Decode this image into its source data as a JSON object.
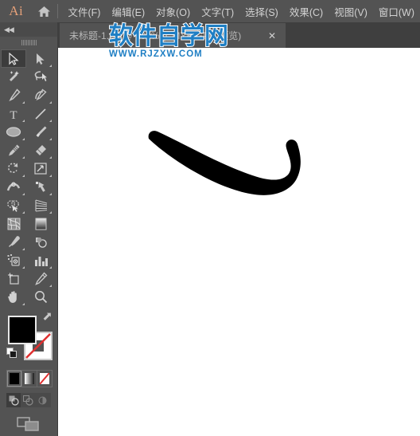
{
  "app": {
    "logo_text": "Ai",
    "home_icon": "home-icon"
  },
  "menubar": {
    "items": [
      {
        "label": "文件(F)",
        "name": "menu-file"
      },
      {
        "label": "编辑(E)",
        "name": "menu-edit"
      },
      {
        "label": "对象(O)",
        "name": "menu-object"
      },
      {
        "label": "文字(T)",
        "name": "menu-type"
      },
      {
        "label": "选择(S)",
        "name": "menu-select"
      },
      {
        "label": "效果(C)",
        "name": "menu-effect"
      },
      {
        "label": "视图(V)",
        "name": "menu-view"
      },
      {
        "label": "窗口(W)",
        "name": "menu-window"
      }
    ]
  },
  "tabbar": {
    "collapse_glyph": "◀◀",
    "tab_label": "未标题-1.ai* @ 100% (CMYK/GPU 预览)",
    "close_glyph": "✕"
  },
  "watermark": {
    "main": "软件自学网",
    "sub": "WWW.RJZXW.COM",
    "color": "#1f7fc4"
  },
  "toolbar": {
    "rows": [
      [
        {
          "label": "选择工具",
          "icon": "selection-arrow-icon",
          "active": true,
          "corner": false
        },
        {
          "label": "直接选择工具",
          "icon": "direct-selection-arrow-icon",
          "active": false,
          "corner": true
        }
      ],
      [
        {
          "label": "魔棒工具",
          "icon": "magic-wand-icon",
          "active": false,
          "corner": false
        },
        {
          "label": "套索工具",
          "icon": "lasso-icon",
          "active": false,
          "corner": false
        }
      ],
      [
        {
          "label": "钢笔工具",
          "icon": "pen-icon",
          "active": false,
          "corner": true
        },
        {
          "label": "曲率工具",
          "icon": "curvature-icon",
          "active": false,
          "corner": true
        }
      ],
      [
        {
          "label": "文字工具",
          "icon": "type-tool-icon",
          "active": false,
          "corner": true
        },
        {
          "label": "直线段工具",
          "icon": "line-segment-icon",
          "active": false,
          "corner": true
        }
      ],
      [
        {
          "label": "椭圆工具",
          "icon": "ellipse-icon",
          "active": false,
          "corner": true
        },
        {
          "label": "画笔工具",
          "icon": "paintbrush-icon",
          "active": false,
          "corner": true
        }
      ],
      [
        {
          "label": "铅笔工具",
          "icon": "pencil-icon",
          "active": false,
          "corner": true
        },
        {
          "label": "橡皮擦工具",
          "icon": "eraser-icon",
          "active": false,
          "corner": true
        }
      ],
      [
        {
          "label": "旋转工具",
          "icon": "rotate-icon",
          "active": false,
          "corner": true
        },
        {
          "label": "比例缩放工具",
          "icon": "scale-icon",
          "active": false,
          "corner": true
        }
      ],
      [
        {
          "label": "宽度工具",
          "icon": "width-tool-icon",
          "active": false,
          "corner": true
        },
        {
          "label": "自由变换工具",
          "icon": "free-transform-icon",
          "active": false,
          "corner": true
        }
      ],
      [
        {
          "label": "形状生成器工具",
          "icon": "shape-builder-icon",
          "active": false,
          "corner": true
        },
        {
          "label": "透视网格工具",
          "icon": "perspective-grid-icon",
          "active": false,
          "corner": true
        }
      ],
      [
        {
          "label": "网格工具",
          "icon": "mesh-icon",
          "active": false,
          "corner": false
        },
        {
          "label": "渐变工具",
          "icon": "gradient-icon",
          "active": false,
          "corner": false
        }
      ],
      [
        {
          "label": "吸管工具",
          "icon": "eyedropper-icon",
          "active": false,
          "corner": true
        },
        {
          "label": "混合工具",
          "icon": "blend-icon",
          "active": false,
          "corner": false
        }
      ],
      [
        {
          "label": "符号喷枪工具",
          "icon": "symbol-sprayer-icon",
          "active": false,
          "corner": true
        },
        {
          "label": "柱形图工具",
          "icon": "column-graph-icon",
          "active": false,
          "corner": true
        }
      ],
      [
        {
          "label": "画板工具",
          "icon": "artboard-icon",
          "active": false,
          "corner": false
        },
        {
          "label": "切片工具",
          "icon": "slice-icon",
          "active": false,
          "corner": true
        }
      ],
      [
        {
          "label": "抓手工具",
          "icon": "hand-icon",
          "active": false,
          "corner": true
        },
        {
          "label": "缩放工具",
          "icon": "zoom-magnifier-icon",
          "active": false,
          "corner": false
        }
      ]
    ],
    "fill_color": "#000000",
    "stroke_color": "none",
    "swap_icon": "swap-fill-stroke-icon",
    "default_icon": "default-fill-stroke-icon",
    "color_modes": [
      {
        "name": "color-mode-solid",
        "selected": true
      },
      {
        "name": "color-mode-gradient",
        "selected": false
      },
      {
        "name": "color-mode-none",
        "selected": false
      }
    ],
    "draw_modes": [
      {
        "name": "draw-normal-mode",
        "selected": true
      },
      {
        "name": "draw-behind-mode",
        "selected": false
      },
      {
        "name": "draw-inside-mode",
        "selected": false
      }
    ],
    "screen_mode": {
      "name": "screen-mode-icon"
    }
  },
  "canvas": {
    "background": "#ffffff",
    "artwork_name": "black-brush-stroke-path",
    "artwork_color": "#000000"
  }
}
